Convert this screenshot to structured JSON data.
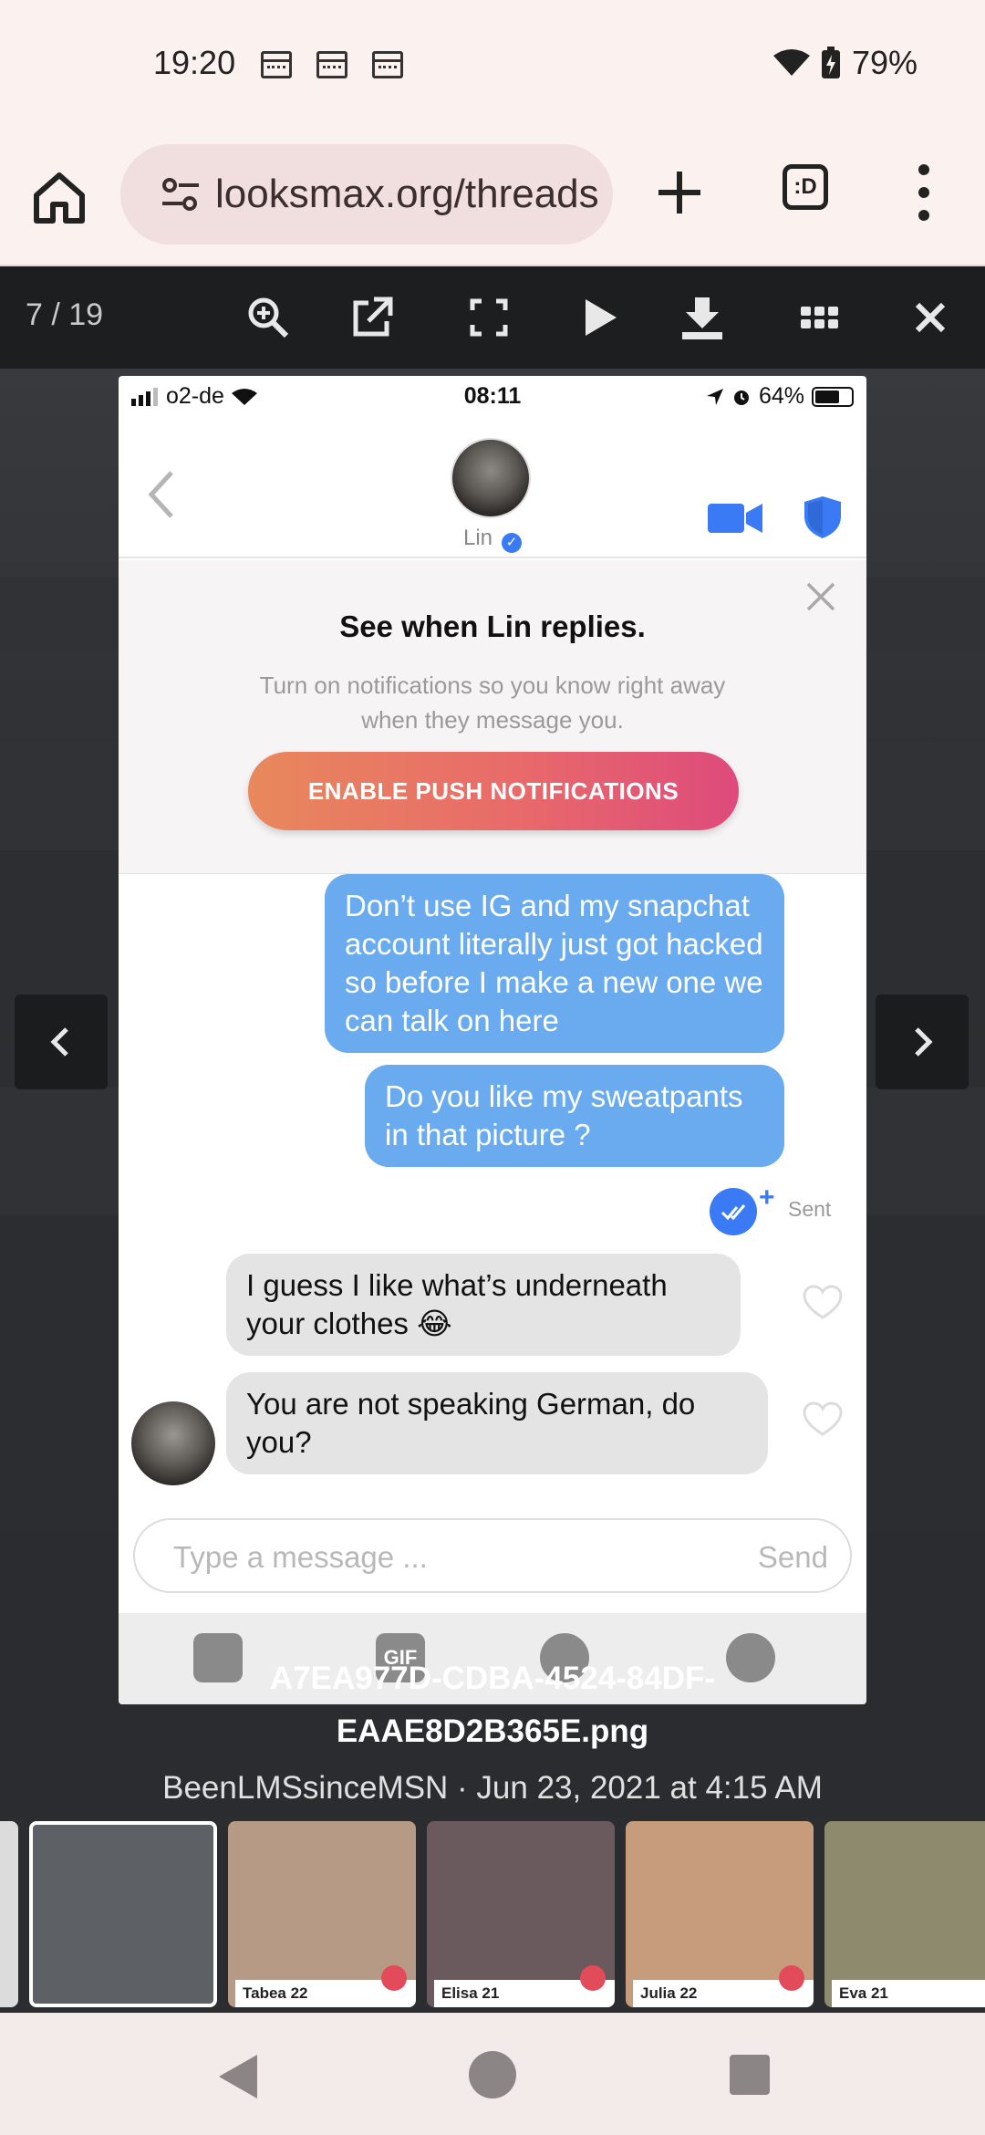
{
  "status_bar": {
    "time": "19:20",
    "battery": "79%",
    "icons": [
      "calendar-icon",
      "calendar-icon",
      "calendar-icon",
      "wifi-icon",
      "battery-charging-icon"
    ]
  },
  "browser": {
    "url": "looksmax.org/threads",
    "tab_count_label": ":D"
  },
  "lightbox": {
    "counter": "7 / 19",
    "tools": [
      "zoom-in-icon",
      "open-external-icon",
      "fullscreen-icon",
      "play-icon",
      "download-icon",
      "grid-icon",
      "close-icon"
    ]
  },
  "inner_screenshot": {
    "status": {
      "carrier": "o2-de",
      "time": "08:11",
      "battery": "64%"
    },
    "contact_name": "Lin",
    "notification": {
      "title": "See when Lin replies.",
      "subtitle": "Turn on notifications so you know right away when they message you.",
      "button": "ENABLE PUSH NOTIFICATIONS"
    },
    "messages": [
      {
        "direction": "out",
        "text": "Don’t use IG and my snapchat account literally just got hacked so before I make a new one we can talk on here"
      },
      {
        "direction": "out",
        "text": "Do you like my sweatpants in that picture ?"
      },
      {
        "direction": "in",
        "text": "I guess I like what’s underneath your clothes 😂"
      },
      {
        "direction": "in",
        "text": "You are not speaking German, do you?"
      }
    ],
    "sent_label": "Sent",
    "sent_plus": "+",
    "composer": {
      "placeholder": "Type a message ...",
      "send": "Send"
    },
    "toolstrip_gif": "GIF"
  },
  "caption": {
    "filename_line1": "A7EA977D-CDBA-4524-84DF-",
    "filename_line2": "EAAE8D2B365E.png",
    "meta": "BeenLMSsinceMSN · Jun 23, 2021 at 4:15 AM"
  },
  "thumbnails": [
    {
      "label": "",
      "color": "#dcdcdc"
    },
    {
      "label": "",
      "color": "#5d6064"
    },
    {
      "label": "Tabea 22",
      "color": "#b79a86"
    },
    {
      "label": "Elisa 21",
      "color": "#6b5a5d"
    },
    {
      "label": "Julia 22",
      "color": "#c69c7c"
    },
    {
      "label": "Eva 21",
      "color": "#8e8a6e"
    }
  ],
  "nav_bar": {
    "icons": [
      "back-icon",
      "home-icon",
      "recents-icon"
    ]
  }
}
